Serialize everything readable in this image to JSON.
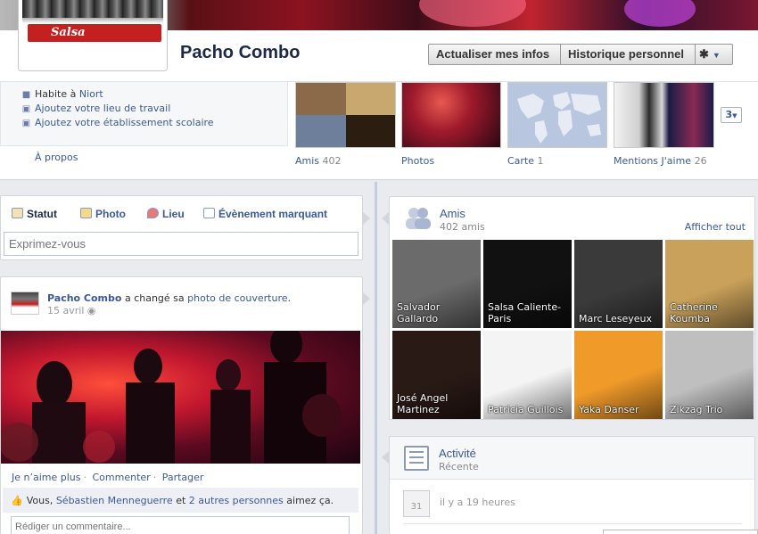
{
  "profile": {
    "name": "Pacho Combo",
    "avatar_text": "Salsa"
  },
  "header_buttons": {
    "update_label": "Actualiser mes infos",
    "history_label": "Historique personnel",
    "gear_icon": "gear-icon",
    "gear_glyph": "✱",
    "dropdown_glyph": "▼"
  },
  "info": {
    "lives_prefix": "Habite à",
    "lives_city": "Niort",
    "workplace_link": "Ajoutez votre lieu de travail",
    "school_link": "Ajoutez votre établissement scolaire",
    "about_link": "À propos"
  },
  "tiles": [
    {
      "label": "Amis",
      "count": "402"
    },
    {
      "label": "Photos",
      "count": ""
    },
    {
      "label": "Carte",
      "count": "1"
    },
    {
      "label": "Mentions J'aime",
      "count": "26"
    }
  ],
  "more_tiles_label": "3",
  "composer": {
    "tabs": [
      "Statut",
      "Photo",
      "Lieu",
      "Évènement marquant"
    ],
    "placeholder": "Exprimez-vous"
  },
  "story": {
    "author": "Pacho Combo",
    "action": "a changé sa",
    "object": "photo de couverture",
    "date": "15 avril",
    "actions": [
      "Je n’aime plus",
      "Commenter",
      "Partager"
    ],
    "likes_prefix": "Vous,",
    "likes_person": "Sébastien Menneguerre",
    "likes_and": "et",
    "likes_others": "2 autres personnes",
    "likes_suffix": "aimez ça.",
    "comment_placeholder": "Rédiger un commentaire..."
  },
  "friends": {
    "title": "Amis",
    "count": "402 amis",
    "see_all": "Afficher tout",
    "items": [
      {
        "name": "Salvador Gallardo",
        "bg": "#6b6b6b"
      },
      {
        "name": "Salsa Caliente-Paris",
        "bg": "#111111"
      },
      {
        "name": "Marc Leseyeux",
        "bg": "#3a3a3a"
      },
      {
        "name": "Catherine Koumba",
        "bg": "#c9a15a"
      },
      {
        "name": "José Angel Martinez",
        "bg": "#2a1a16"
      },
      {
        "name": "Patricia Guillois",
        "bg": "#f4f4f4"
      },
      {
        "name": "Yaka Danser",
        "bg": "#f09a2a"
      },
      {
        "name": "Zikzag Trio",
        "bg": "#bfbfbf"
      }
    ]
  },
  "activity": {
    "title": "Activité",
    "subtitle": "Récente",
    "calendar_day": "31",
    "time": "il y a 19 heures"
  }
}
